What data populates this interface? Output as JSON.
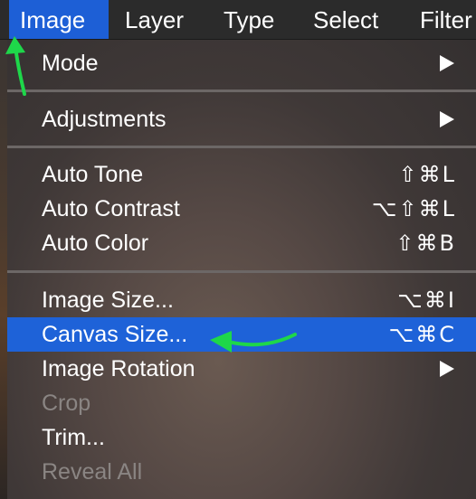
{
  "menubar": {
    "items": [
      {
        "label": "Image"
      },
      {
        "label": "Layer"
      },
      {
        "label": "Type"
      },
      {
        "label": "Select"
      },
      {
        "label": "Filter"
      }
    ]
  },
  "dropdown": {
    "mode": {
      "label": "Mode"
    },
    "adjustments": {
      "label": "Adjustments"
    },
    "auto_tone": {
      "label": "Auto Tone",
      "shortcut": "⇧⌘L"
    },
    "auto_contrast": {
      "label": "Auto Contrast",
      "shortcut": "⌥⇧⌘L"
    },
    "auto_color": {
      "label": "Auto Color",
      "shortcut": "⇧⌘B"
    },
    "image_size": {
      "label": "Image Size...",
      "shortcut": "⌥⌘I"
    },
    "canvas_size": {
      "label": "Canvas Size...",
      "shortcut": "⌥⌘C"
    },
    "image_rotation": {
      "label": "Image Rotation"
    },
    "crop": {
      "label": "Crop"
    },
    "trim": {
      "label": "Trim..."
    },
    "reveal_all": {
      "label": "Reveal All"
    }
  },
  "colors": {
    "highlight": "#1e62d8",
    "annotation_arrow": "#1ed74a"
  }
}
